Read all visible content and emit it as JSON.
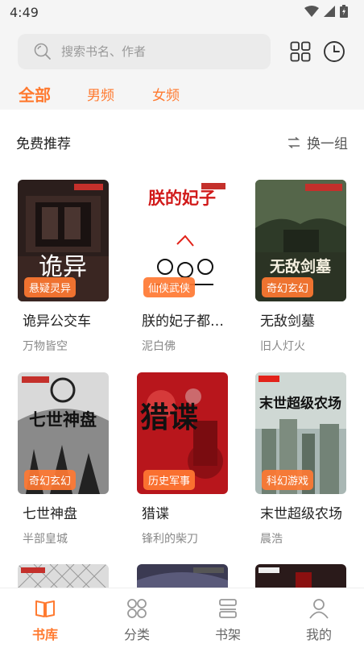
{
  "status_bar": {
    "time": "4:49",
    "icons": [
      "wifi-icon",
      "signal-icon",
      "battery-icon"
    ]
  },
  "search": {
    "placeholder": "搜索书名、作者",
    "icon": "search-icon"
  },
  "header_actions": [
    "grid-icon",
    "history-clock-icon"
  ],
  "category_tabs": [
    {
      "label": "全部",
      "active": true
    },
    {
      "label": "男频",
      "active": false
    },
    {
      "label": "女频",
      "active": false
    }
  ],
  "section": {
    "title": "免费推荐",
    "refresh_label": "换一组",
    "refresh_icon": "refresh-icon"
  },
  "books": [
    {
      "title": "诡异公交车",
      "author": "万物皆空",
      "tag": "悬疑灵异",
      "cover_text": "诡异"
    },
    {
      "title": "朕的妃子都是猫",
      "author": "泥白佛",
      "tag": "仙侠武侠",
      "cover_text": "朕的妃子"
    },
    {
      "title": "无敌剑墓",
      "author": "旧人灯火",
      "tag": "奇幻玄幻",
      "cover_text": "无敌剑墓"
    },
    {
      "title": "七世神盘",
      "author": "半部皇城",
      "tag": "奇幻玄幻",
      "cover_text": "七世神盘"
    },
    {
      "title": "猎谍",
      "author": "锋利的柴刀",
      "tag": "历史军事",
      "cover_text": "猎谍"
    },
    {
      "title": "末世超级农场",
      "author": "晨浩",
      "tag": "科幻游戏",
      "cover_text": "末世超级农场"
    }
  ],
  "bottom_nav": [
    {
      "label": "书库",
      "icon": "book-open-icon",
      "active": true
    },
    {
      "label": "分类",
      "icon": "category-icon",
      "active": false
    },
    {
      "label": "书架",
      "icon": "bookshelf-icon",
      "active": false
    },
    {
      "label": "我的",
      "icon": "user-icon",
      "active": false
    }
  ],
  "colors": {
    "accent": "#ff7a30",
    "tag_bg": "#ff7832",
    "page_bg": "#f5f5f5"
  }
}
